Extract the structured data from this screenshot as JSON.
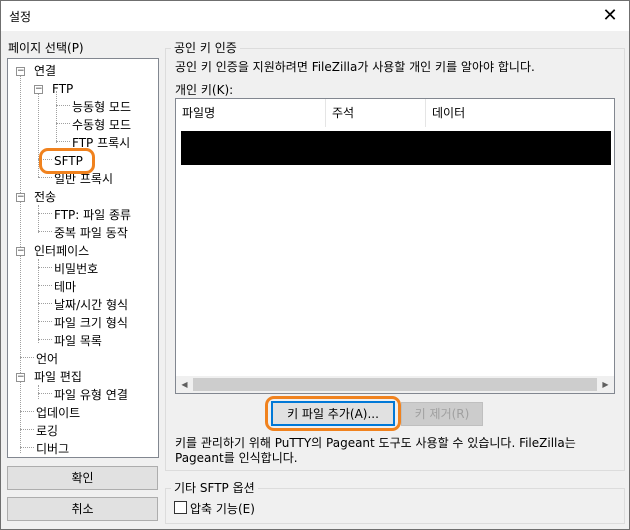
{
  "window": {
    "title": "설정",
    "close_glyph": "✕"
  },
  "page_select_label": "페이지 선택(P)",
  "tree": [
    {
      "id": "conn",
      "label": "연결",
      "expander": "−"
    },
    {
      "id": "ftp",
      "label": "FTP",
      "expander": "−"
    },
    {
      "id": "active",
      "label": "능동형 모드"
    },
    {
      "id": "passive",
      "label": "수동형 모드"
    },
    {
      "id": "ftpproxy",
      "label": "FTP 프록시"
    },
    {
      "id": "sftp",
      "label": "SFTP",
      "selected": true
    },
    {
      "id": "genproxy",
      "label": "일반 프록시"
    },
    {
      "id": "transfer",
      "label": "전송",
      "expander": "−"
    },
    {
      "id": "filetype",
      "label": "FTP: 파일 종류"
    },
    {
      "id": "dupfile",
      "label": "중복 파일 동작"
    },
    {
      "id": "interface",
      "label": "인터페이스",
      "expander": "−"
    },
    {
      "id": "password",
      "label": "비밀번호"
    },
    {
      "id": "theme",
      "label": "테마"
    },
    {
      "id": "datetime",
      "label": "날짜/시간 형식"
    },
    {
      "id": "filesize",
      "label": "파일 크기 형식"
    },
    {
      "id": "filelist",
      "label": "파일 목록"
    },
    {
      "id": "language",
      "label": "언어"
    },
    {
      "id": "fileedit",
      "label": "파일 편집",
      "expander": "−"
    },
    {
      "id": "filetypeassoc",
      "label": "파일 유형 연결"
    },
    {
      "id": "update",
      "label": "업데이트"
    },
    {
      "id": "logging",
      "label": "로깅"
    },
    {
      "id": "debug",
      "label": "디버그"
    }
  ],
  "buttons": {
    "ok": "확인",
    "cancel": "취소"
  },
  "pubkey": {
    "group_title": "공인 키 인증",
    "description": "공인 키 인증을 지원하려면 FileZilla가 사용할 개인 키를 알아야 합니다.",
    "private_key_label": "개인 키(K):",
    "columns": [
      "파일명",
      "주석",
      "데이터"
    ],
    "add_button": "키 파일 추가(A)...",
    "remove_button": "키 제거(R)",
    "pageant_note_line1": "키를 관리하기 위해 PuTTY의 Pageant 도구도 사용할 수 있습니다. FileZilla는",
    "pageant_note_line2": "Pageant를 인식합니다."
  },
  "other": {
    "group_title": "기타 SFTP 옵션",
    "compression_label": "압축 기능(E)",
    "compression_checked": false
  },
  "colors": {
    "highlight": "#f0821e",
    "default_button_border": "#0078d7"
  }
}
